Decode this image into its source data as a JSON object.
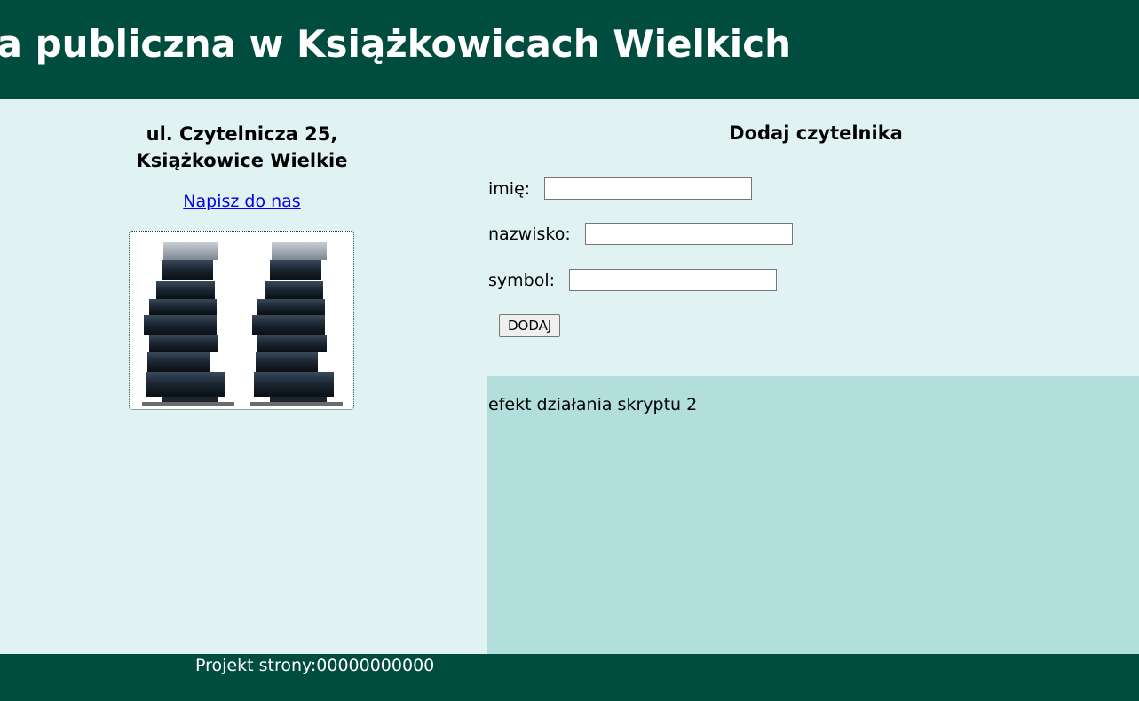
{
  "header": {
    "title": "Biblioteka publiczna w Książkowicach Wielkich"
  },
  "left": {
    "address_line1": "ul. Czytelnicza 25,",
    "address_line2": "Książkowice Wielkie",
    "mail_link": "Napisz do nas"
  },
  "form": {
    "title": "Dodaj czytelnika",
    "fields": [
      {
        "label": "imię:",
        "value": ""
      },
      {
        "label": "nazwisko:",
        "value": ""
      },
      {
        "label": "symbol:",
        "value": ""
      }
    ],
    "submit_label": "DODAJ"
  },
  "result": {
    "text": "efekt działania skryptu 2"
  },
  "footer": {
    "text": "Projekt strony:00000000000"
  },
  "colors": {
    "header_bg": "#004d40",
    "panel_bg": "#e0f2f1",
    "result_bg": "#b2dfdb",
    "link": "#0000ee"
  }
}
